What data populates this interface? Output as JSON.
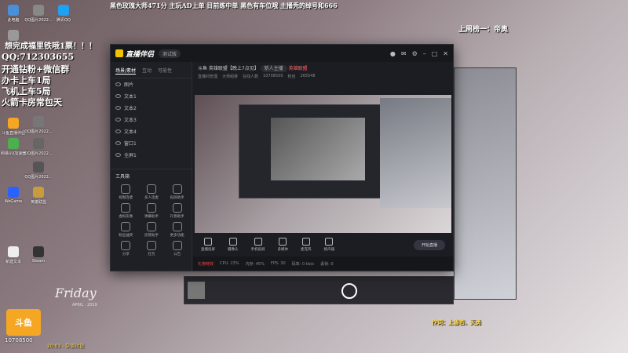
{
  "top_banner": {
    "text": "黑色玫瑰大师471分  主玩AD上单  目前练中单  黑色有车位哦  主播秃的绰号和666",
    "rank_label": "上周榜一：帝奥"
  },
  "overlay": {
    "line1": "想完成福里铁哦1票！！！",
    "qq": "QQ:712303655",
    "line3": "开通钻粉+微信群",
    "line4": "办卡上车1局",
    "line5": "飞机上车5局",
    "line6": "火箭卡房常包天",
    "lyrics_credit": "作词：上善若、天勇",
    "friday": "Friday",
    "friday_sub": "APRIL · 2019",
    "bottom_text": "20:03 - 杂谈讨论"
  },
  "desktop_icons": [
    {
      "label": "此电脑",
      "icon": "computer-icon",
      "color": "#4a90d9"
    },
    {
      "label": "QQ图片2022...",
      "icon": "image-icon",
      "color": "#888"
    },
    {
      "label": "腾讯QQ",
      "icon": "qq-icon",
      "color": "#1ea1f2"
    },
    {
      "label": "回收站",
      "icon": "recycle-icon",
      "color": "#999"
    },
    {
      "label": "QQ图片2022...",
      "icon": "image-icon",
      "color": "#777"
    },
    {
      "label": "斗鱼直播伴侣",
      "icon": "douyu-icon",
      "color": "#f5a623"
    },
    {
      "label": "QQ图片2022...",
      "icon": "image-icon",
      "color": "#666"
    },
    {
      "label": "网易UU加速器",
      "icon": "uu-icon",
      "color": "#4caf50"
    },
    {
      "label": "QQ图片2022...",
      "icon": "image-icon",
      "color": "#555"
    },
    {
      "label": "WeGame",
      "icon": "wegame-icon",
      "color": "#2962ff"
    },
    {
      "label": "英雄联盟",
      "icon": "lol-icon",
      "color": "#c89b3c"
    },
    {
      "label": "新建文本",
      "icon": "text-icon",
      "color": "#eee"
    },
    {
      "label": "Steam",
      "icon": "steam-icon",
      "color": "#333"
    }
  ],
  "douyu_badge": {
    "title": "斗鱼",
    "id": "10708500"
  },
  "window": {
    "app_name": "直播伴侣",
    "version": "测试版",
    "tabs": [
      "场景/素材",
      "互动",
      "可能性"
    ],
    "scenes": [
      "图片",
      "文本1",
      "文本2",
      "文本3",
      "文本4",
      "窗口1",
      "全屏1"
    ],
    "tools_header": "工具箱",
    "tools": [
      "视频连麦",
      "多人连麦",
      "投屏助手",
      "虚拟形象",
      "弹幕助手",
      "礼物助手",
      "粉丝抽奖",
      "房管助手",
      "更多功能",
      "分享",
      "红包",
      "公告"
    ],
    "room_title": "斗鱼  英雄联盟【晚上7点见】",
    "room_tag": "新人主播",
    "category": "英雄联盟",
    "stats": [
      "直播间管理",
      "大师组排",
      "在线人数",
      "10708500",
      "粉丝",
      "265548"
    ],
    "bottom_buttons": [
      "直播投屏",
      "摄像头",
      "手机投屏",
      "多媒体",
      "麦克风",
      "扬声器"
    ],
    "start_button": "开始直播",
    "status_text": "礼物特效",
    "status_items": [
      "CPU: 23%",
      "内存: 45%",
      "FPS: 30",
      "码率: 0 kb/s",
      "丢帧: 0"
    ]
  }
}
